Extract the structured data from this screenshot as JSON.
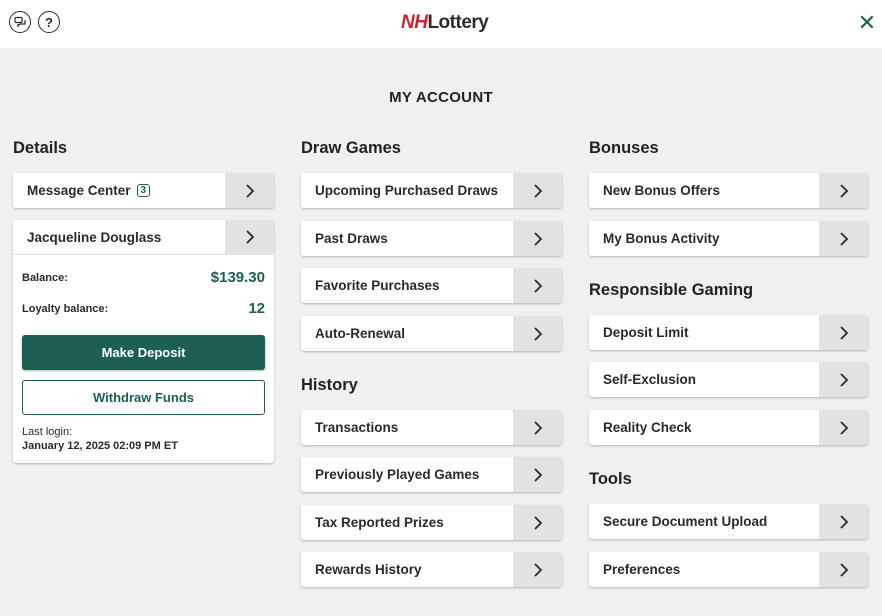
{
  "header": {
    "logo_nh": "NH",
    "logo_lottery": "Lottery",
    "close_glyph": "✕",
    "help_glyph": "?"
  },
  "page": {
    "title": "MY ACCOUNT"
  },
  "details": {
    "heading": "Details",
    "message_center": {
      "label": "Message Center",
      "badge": "3"
    },
    "account": {
      "name": "Jacqueline Douglass",
      "balance_label": "Balance:",
      "balance_value": "$139.30",
      "loyalty_label": "Loyalty balance:",
      "loyalty_value": "12",
      "deposit_button": "Make Deposit",
      "withdraw_button": "Withdraw Funds",
      "last_login_label": "Last login:",
      "last_login_value": "January 12, 2025 02:09 PM ET"
    }
  },
  "draw_games": {
    "heading": "Draw Games",
    "items": [
      "Upcoming Purchased Draws",
      "Past Draws",
      "Favorite Purchases",
      "Auto-Renewal"
    ]
  },
  "history": {
    "heading": "History",
    "items": [
      "Transactions",
      "Previously Played Games",
      "Tax Reported Prizes",
      "Rewards History"
    ]
  },
  "bonuses": {
    "heading": "Bonuses",
    "items": [
      "New Bonus Offers",
      "My Bonus Activity"
    ]
  },
  "responsible_gaming": {
    "heading": "Responsible Gaming",
    "items": [
      "Deposit Limit",
      "Self-Exclusion",
      "Reality Check"
    ]
  },
  "tools": {
    "heading": "Tools",
    "items": [
      "Secure Document Upload",
      "Preferences"
    ]
  },
  "icons": {
    "chat": "chat-icon",
    "help": "help-icon",
    "close": "close-icon",
    "chevron": "chevron-right-icon"
  },
  "colors": {
    "brand_green": "#1d5e55",
    "logo_red": "#d1202f",
    "arrow_bg": "#e2e2e2",
    "page_bg": "#f0f0f0"
  }
}
